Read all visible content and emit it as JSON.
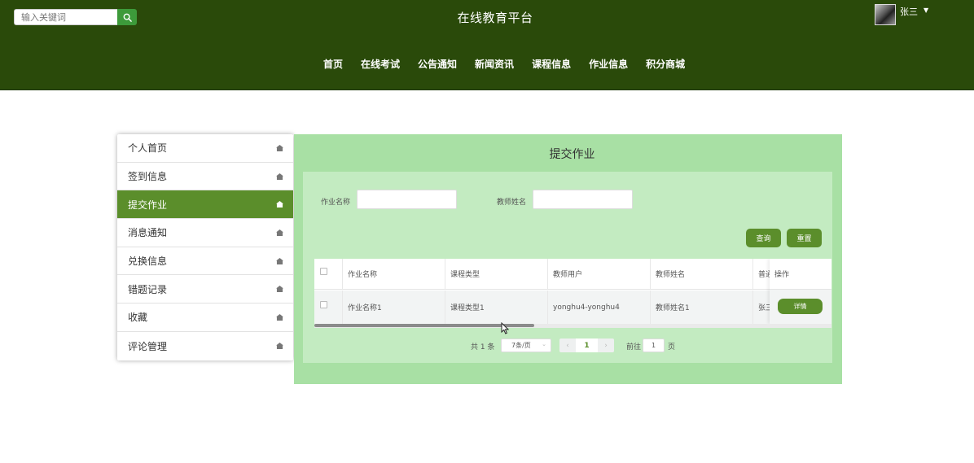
{
  "header": {
    "search_placeholder": "输入关键词",
    "title": "在线教育平台",
    "user_name": "张三",
    "nav": [
      "首页",
      "在线考试",
      "公告通知",
      "新闻资讯",
      "课程信息",
      "作业信息",
      "积分商城"
    ]
  },
  "sidebar": {
    "items": [
      {
        "label": "个人首页",
        "icon": "home-icon"
      },
      {
        "label": "签到信息",
        "icon": "home-icon"
      },
      {
        "label": "提交作业",
        "icon": "home-icon"
      },
      {
        "label": "消息通知",
        "icon": "home-icon"
      },
      {
        "label": "兑换信息",
        "icon": "home-icon"
      },
      {
        "label": "错题记录",
        "icon": "home-icon"
      },
      {
        "label": "收藏",
        "icon": "home-icon"
      },
      {
        "label": "评论管理",
        "icon": "home-icon"
      }
    ],
    "active_index": 2
  },
  "main": {
    "title": "提交作业",
    "filters": [
      {
        "label": "作业名称",
        "value": ""
      },
      {
        "label": "教师姓名",
        "value": ""
      }
    ],
    "query_label": "查询",
    "reset_label": "重置",
    "table": {
      "columns": [
        "作业名称",
        "课程类型",
        "教师用户",
        "教师姓名",
        "普通"
      ],
      "op_column": "操作",
      "rows": [
        {
          "cells": [
            "作业名称1",
            "课程类型1",
            "yonghu4-yonghu4",
            "教师姓名1",
            "张三"
          ],
          "action": "详情"
        }
      ]
    },
    "pagination": {
      "total": "共 1 条",
      "page_size": "7条/页",
      "current_page": "1",
      "goto_prefix": "前往",
      "goto_value": "1",
      "goto_suffix": "页"
    }
  },
  "colors": {
    "header_bg": "#2a4a0a",
    "accent": "#5b8e2b",
    "panel_bg": "#a8e0a4",
    "inner_bg": "#c3ebc1",
    "search_btn": "#3d9a3a"
  }
}
